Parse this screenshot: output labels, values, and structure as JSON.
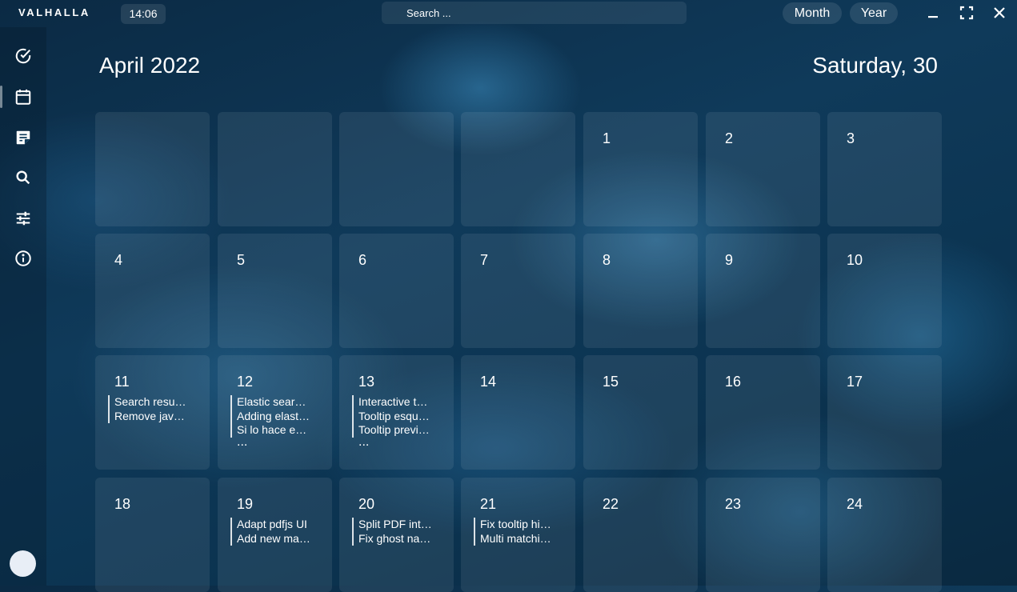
{
  "app": {
    "name": "VALHALLA",
    "time": "14:06"
  },
  "search": {
    "placeholder": "Search ..."
  },
  "view_switch": {
    "month_label": "Month",
    "year_label": "Year"
  },
  "sidebar": {
    "items": [
      {
        "name": "tasks",
        "icon": "check-circle-icon",
        "active": false
      },
      {
        "name": "calendar",
        "icon": "calendar-icon",
        "active": true
      },
      {
        "name": "notes",
        "icon": "note-icon",
        "active": false
      },
      {
        "name": "search",
        "icon": "search-icon",
        "active": false
      },
      {
        "name": "settings",
        "icon": "tune-icon",
        "active": false
      },
      {
        "name": "info",
        "icon": "info-icon",
        "active": false
      }
    ]
  },
  "calendar": {
    "month_label": "April 2022",
    "selected_day_label": "Saturday, 30",
    "weeks": [
      [
        {
          "day": "",
          "events": [],
          "more": ""
        },
        {
          "day": "",
          "events": [],
          "more": ""
        },
        {
          "day": "",
          "events": [],
          "more": ""
        },
        {
          "day": "",
          "events": [],
          "more": ""
        },
        {
          "day": "1",
          "events": [],
          "more": ""
        },
        {
          "day": "2",
          "events": [],
          "more": ""
        },
        {
          "day": "3",
          "events": [],
          "more": ""
        }
      ],
      [
        {
          "day": "4",
          "events": [],
          "more": ""
        },
        {
          "day": "5",
          "events": [],
          "more": ""
        },
        {
          "day": "6",
          "events": [],
          "more": ""
        },
        {
          "day": "7",
          "events": [],
          "more": ""
        },
        {
          "day": "8",
          "events": [],
          "more": ""
        },
        {
          "day": "9",
          "events": [],
          "more": ""
        },
        {
          "day": "10",
          "events": [],
          "more": ""
        }
      ],
      [
        {
          "day": "11",
          "events": [
            "Search resu…",
            "Remove jav…"
          ],
          "more": ""
        },
        {
          "day": "12",
          "events": [
            "Elastic sear…",
            "Adding elast…",
            "Si lo hace e…"
          ],
          "more": "..."
        },
        {
          "day": "13",
          "events": [
            "Interactive t…",
            "Tooltip esqu…",
            "Tooltip previ…"
          ],
          "more": "..."
        },
        {
          "day": "14",
          "events": [],
          "more": ""
        },
        {
          "day": "15",
          "events": [],
          "more": ""
        },
        {
          "day": "16",
          "events": [],
          "more": ""
        },
        {
          "day": "17",
          "events": [],
          "more": ""
        }
      ],
      [
        {
          "day": "18",
          "events": [],
          "more": ""
        },
        {
          "day": "19",
          "events": [
            "Adapt pdfjs UI",
            "Add new ma…"
          ],
          "more": ""
        },
        {
          "day": "20",
          "events": [
            "Split PDF int…",
            "Fix ghost na…"
          ],
          "more": ""
        },
        {
          "day": "21",
          "events": [
            "Fix tooltip hi…",
            "Multi matchi…"
          ],
          "more": ""
        },
        {
          "day": "22",
          "events": [],
          "more": ""
        },
        {
          "day": "23",
          "events": [],
          "more": ""
        },
        {
          "day": "24",
          "events": [],
          "more": ""
        }
      ]
    ]
  }
}
